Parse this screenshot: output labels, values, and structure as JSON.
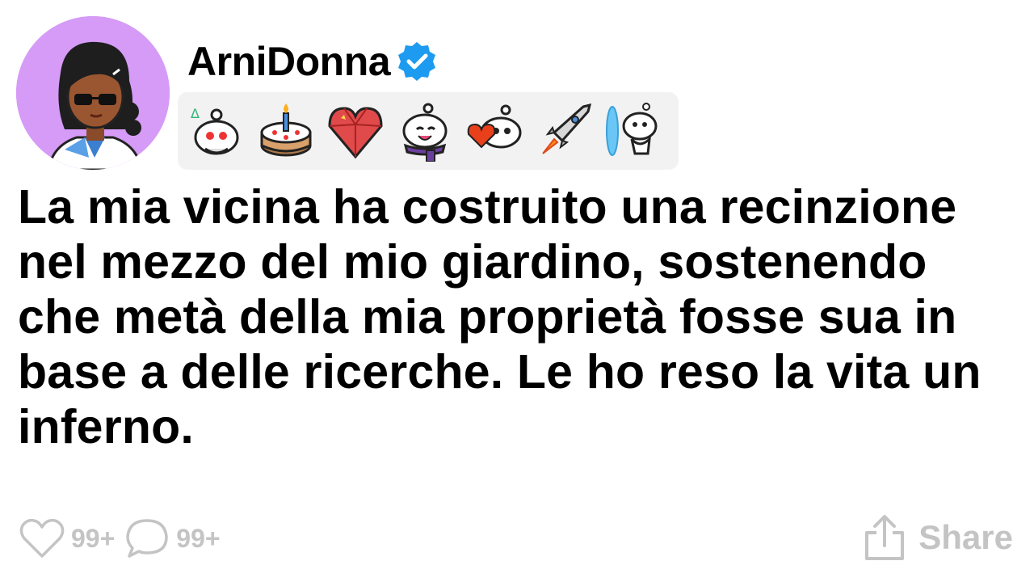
{
  "post": {
    "username": "ArniDonna",
    "text": "La mia vicina ha costruito una recinzione nel mezzo del mio giardino, sostenendo che metà della mia proprietà fosse sua in base a delle ricerche. Le ho reso la vita un inferno."
  },
  "badges": [
    {
      "icon": "snoo-confused-badge-icon"
    },
    {
      "icon": "birthday-cake-badge-icon"
    },
    {
      "icon": "crystal-heart-badge-icon"
    },
    {
      "icon": "snoo-scarf-badge-icon"
    },
    {
      "icon": "snoo-heart-badge-icon"
    },
    {
      "icon": "rocket-badge-icon"
    },
    {
      "icon": "portal-snoo-badge-icon"
    }
  ],
  "actions": {
    "likes": "99+",
    "comments": "99+",
    "share_label": "Share"
  },
  "colors": {
    "avatar_bg": "#d59bf6",
    "verified": "#1d9bf0",
    "muted": "#c4c4c4",
    "badge_bar": "#f2f2f3"
  }
}
